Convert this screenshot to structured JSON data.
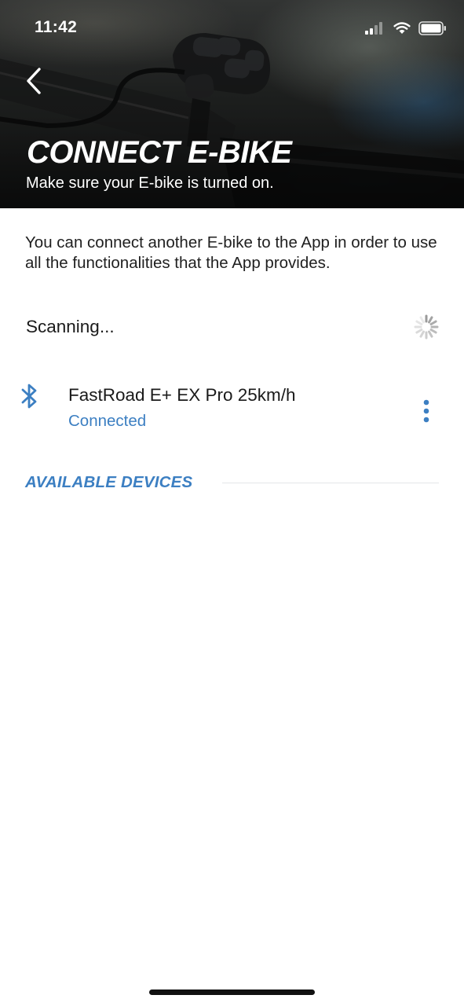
{
  "status_bar": {
    "time": "11:42",
    "icons": [
      "cellular-signal-icon",
      "wifi-icon",
      "battery-icon"
    ]
  },
  "header": {
    "back_icon": "chevron-left-icon",
    "title": "CONNECT E-BIKE",
    "subtitle": "Make sure your E-bike is turned on."
  },
  "main": {
    "intro": "You can connect another E-bike to the App in order to use all the functionalities that the App provides.",
    "scanning": {
      "label": "Scanning...",
      "icon": "loading-spinner-icon"
    },
    "connected_device": {
      "icon": "bluetooth-icon",
      "name": "FastRoad E+ EX Pro 25km/h",
      "status": "Connected",
      "menu_icon": "more-vertical-icon"
    },
    "available_devices": {
      "title": "AVAILABLE DEVICES",
      "items": []
    }
  },
  "colors": {
    "accent": "#3c7fc2",
    "text": "#1a1a1a",
    "background": "#ffffff",
    "divider": "#e3e6e8"
  }
}
